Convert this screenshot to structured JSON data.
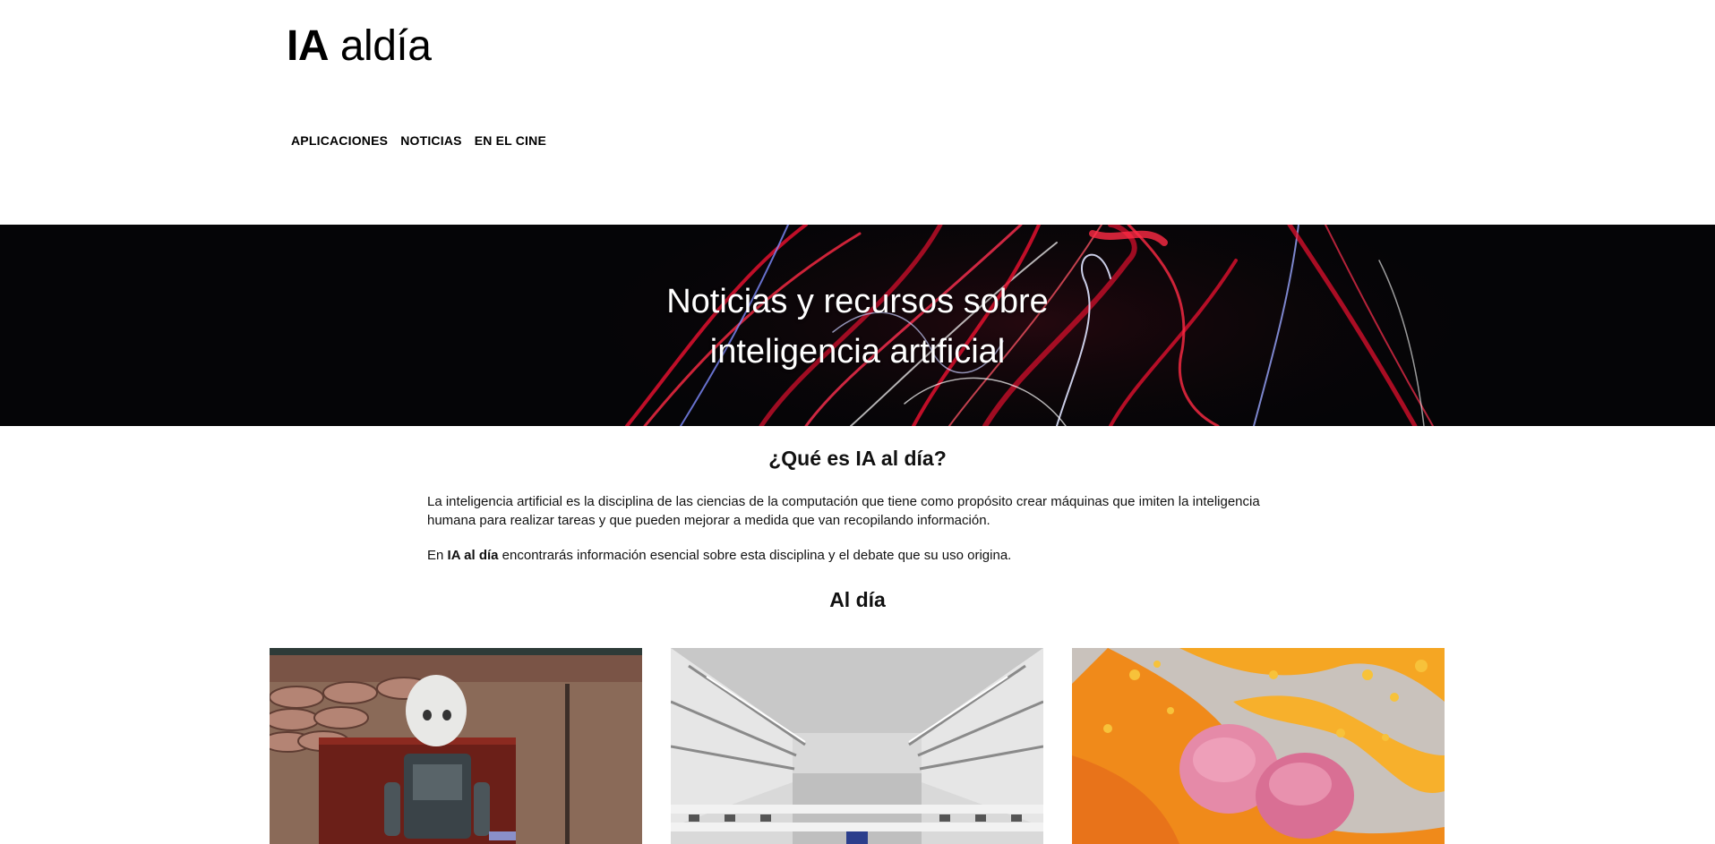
{
  "header": {
    "logo_bold": "IA",
    "logo_light": "aldía",
    "nav": [
      {
        "label": "APLICACIONES"
      },
      {
        "label": "NOTICIAS"
      },
      {
        "label": "EN EL CINE"
      }
    ]
  },
  "hero": {
    "title_line1": "Noticias y recursos sobre",
    "title_line2": "inteligencia artificial"
  },
  "about": {
    "heading": "¿Qué es IA al día?",
    "paragraph1": "La inteligencia artificial es la disciplina de las ciencias de la computación que tiene como propósito crear máquinas que imiten la inteligencia humana para realizar tareas y que pueden mejorar a medida que van recopilando información.",
    "paragraph2_prefix": "En",
    "paragraph2_brand": "IA al día",
    "paragraph2_suffix": "encontrarás información esencial sobre esta disciplina y el debate que su uso origina."
  },
  "news": {
    "heading": "Al día",
    "cards": [
      {
        "image": "robot-on-bench-photo"
      },
      {
        "image": "parliament-hall-photo"
      },
      {
        "image": "orange-pink-abstract-render"
      }
    ]
  },
  "colors": {
    "text": "#111111",
    "hero_bg": "#050507",
    "accent_red": "#e0102e",
    "accent_blue": "#6f7cff"
  }
}
